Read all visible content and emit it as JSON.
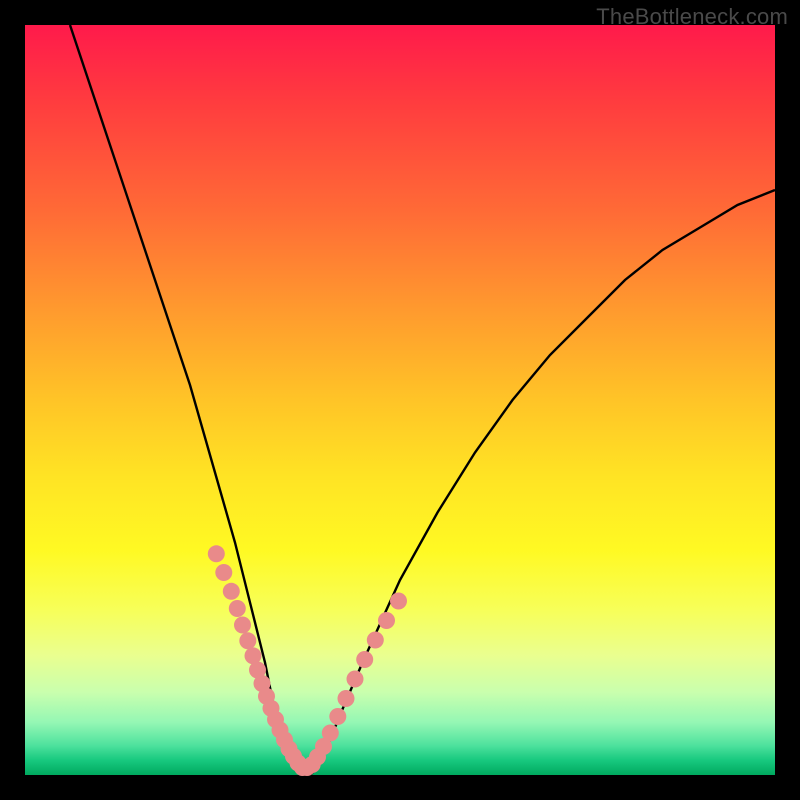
{
  "watermark": {
    "text": "TheBottleneck.com"
  },
  "chart_data": {
    "type": "line",
    "title": "",
    "xlabel": "",
    "ylabel": "",
    "xlim": [
      0,
      100
    ],
    "ylim": [
      0,
      100
    ],
    "series": [
      {
        "name": "bottleneck-curve",
        "x": [
          6,
          10,
          14,
          18,
          22,
          26,
          28,
          30,
          32,
          33,
          34,
          35,
          36,
          37,
          38,
          39,
          40,
          42,
          45,
          50,
          55,
          60,
          65,
          70,
          75,
          80,
          85,
          90,
          95,
          100
        ],
        "y": [
          100,
          88,
          76,
          64,
          52,
          38,
          31,
          23,
          15,
          10,
          6,
          3,
          1,
          0,
          0,
          1,
          3,
          8,
          15,
          26,
          35,
          43,
          50,
          56,
          61,
          66,
          70,
          73,
          76,
          78
        ]
      }
    ],
    "markers": {
      "name": "highlight-dots",
      "color": "#e98a8a",
      "points_x": [
        25.5,
        26.5,
        27.5,
        28.3,
        29.0,
        29.7,
        30.4,
        31.0,
        31.6,
        32.2,
        32.8,
        33.4,
        34.0,
        34.6,
        35.2,
        35.8,
        36.4,
        37.0,
        37.6,
        38.3,
        39.0,
        39.8,
        40.7,
        41.7,
        42.8,
        44.0,
        45.3,
        46.7,
        48.2,
        49.8
      ],
      "points_y": [
        29.5,
        27.0,
        24.5,
        22.2,
        20.0,
        17.9,
        15.9,
        14.0,
        12.2,
        10.5,
        8.9,
        7.4,
        6.0,
        4.7,
        3.5,
        2.5,
        1.6,
        1.0,
        1.0,
        1.4,
        2.4,
        3.8,
        5.6,
        7.8,
        10.2,
        12.8,
        15.4,
        18.0,
        20.6,
        23.2
      ]
    }
  }
}
